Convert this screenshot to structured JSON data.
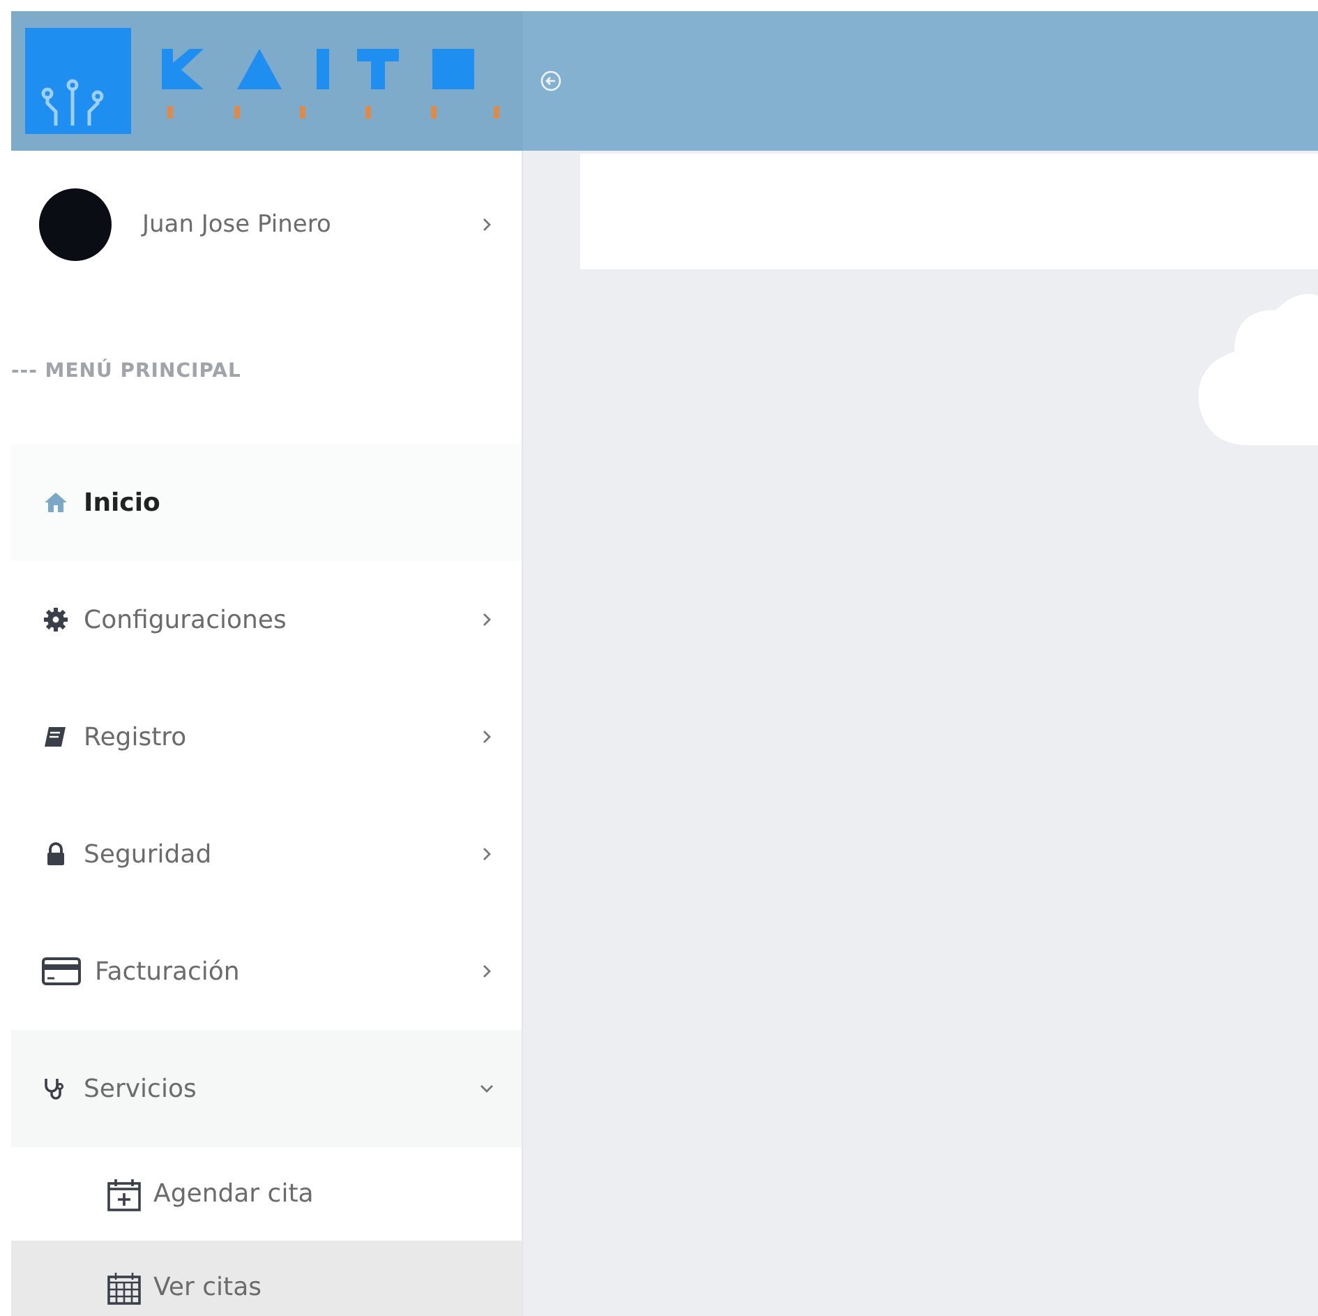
{
  "user": {
    "name": "Juan Jose Pinero"
  },
  "menu": {
    "heading": "--- MENÚ PRINCIPAL",
    "items": [
      {
        "label": "Inicio",
        "selected": true
      },
      {
        "label": "Configuraciones",
        "selected": false,
        "expanded": false
      },
      {
        "label": "Registro",
        "selected": false,
        "expanded": false
      },
      {
        "label": "Seguridad",
        "selected": false,
        "expanded": false
      },
      {
        "label": "Facturación",
        "selected": false,
        "expanded": false
      },
      {
        "label": "Servicios",
        "selected": false,
        "expanded": true,
        "children": [
          {
            "label": "Agendar cita",
            "selected": false
          },
          {
            "label": "Ver citas",
            "selected": true
          }
        ]
      }
    ]
  }
}
